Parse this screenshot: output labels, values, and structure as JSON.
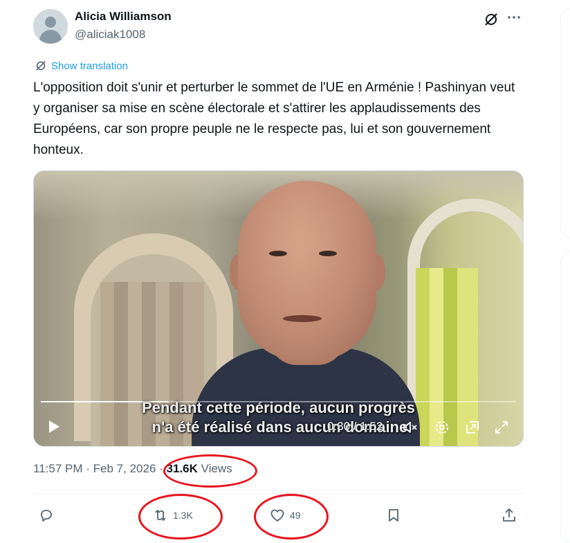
{
  "author": {
    "name": "Alicia Williamson",
    "handle": "@aliciak1008"
  },
  "translation": {
    "label": "Show translation"
  },
  "tweet": {
    "text": "L'opposition doit s'unir et perturber le sommet de l'UE en Arménie ! Pashinyan veut y organiser sa mise en scène électorale et s'attirer les applaudissements des Européens, car son propre peuple ne le respecte pas, lui et son gouvernement honteux."
  },
  "video": {
    "subtitle_line1": "Pendant cette période, aucun progrès",
    "subtitle_line2": "n'a été réalisé dans aucun domaine.",
    "time": "0:30 / 1:52",
    "progress_fraction": 0.268
  },
  "meta": {
    "time": "11:57 PM",
    "separator": "·",
    "date": "Feb 7, 2026",
    "views_count": "31.6K",
    "views_label": "Views"
  },
  "actions": {
    "retweets": "1.3K",
    "likes": "49"
  },
  "colors": {
    "accent": "#1d9bf0",
    "secondary_text": "#536471",
    "annotation": "#e8141d"
  },
  "icons": [
    "grok-icon",
    "more-icon",
    "translate-icon",
    "play-icon",
    "mute-icon",
    "settings-icon",
    "pip-icon",
    "fullscreen-icon",
    "reply-icon",
    "retweet-icon",
    "like-icon",
    "bookmark-icon",
    "share-icon"
  ]
}
